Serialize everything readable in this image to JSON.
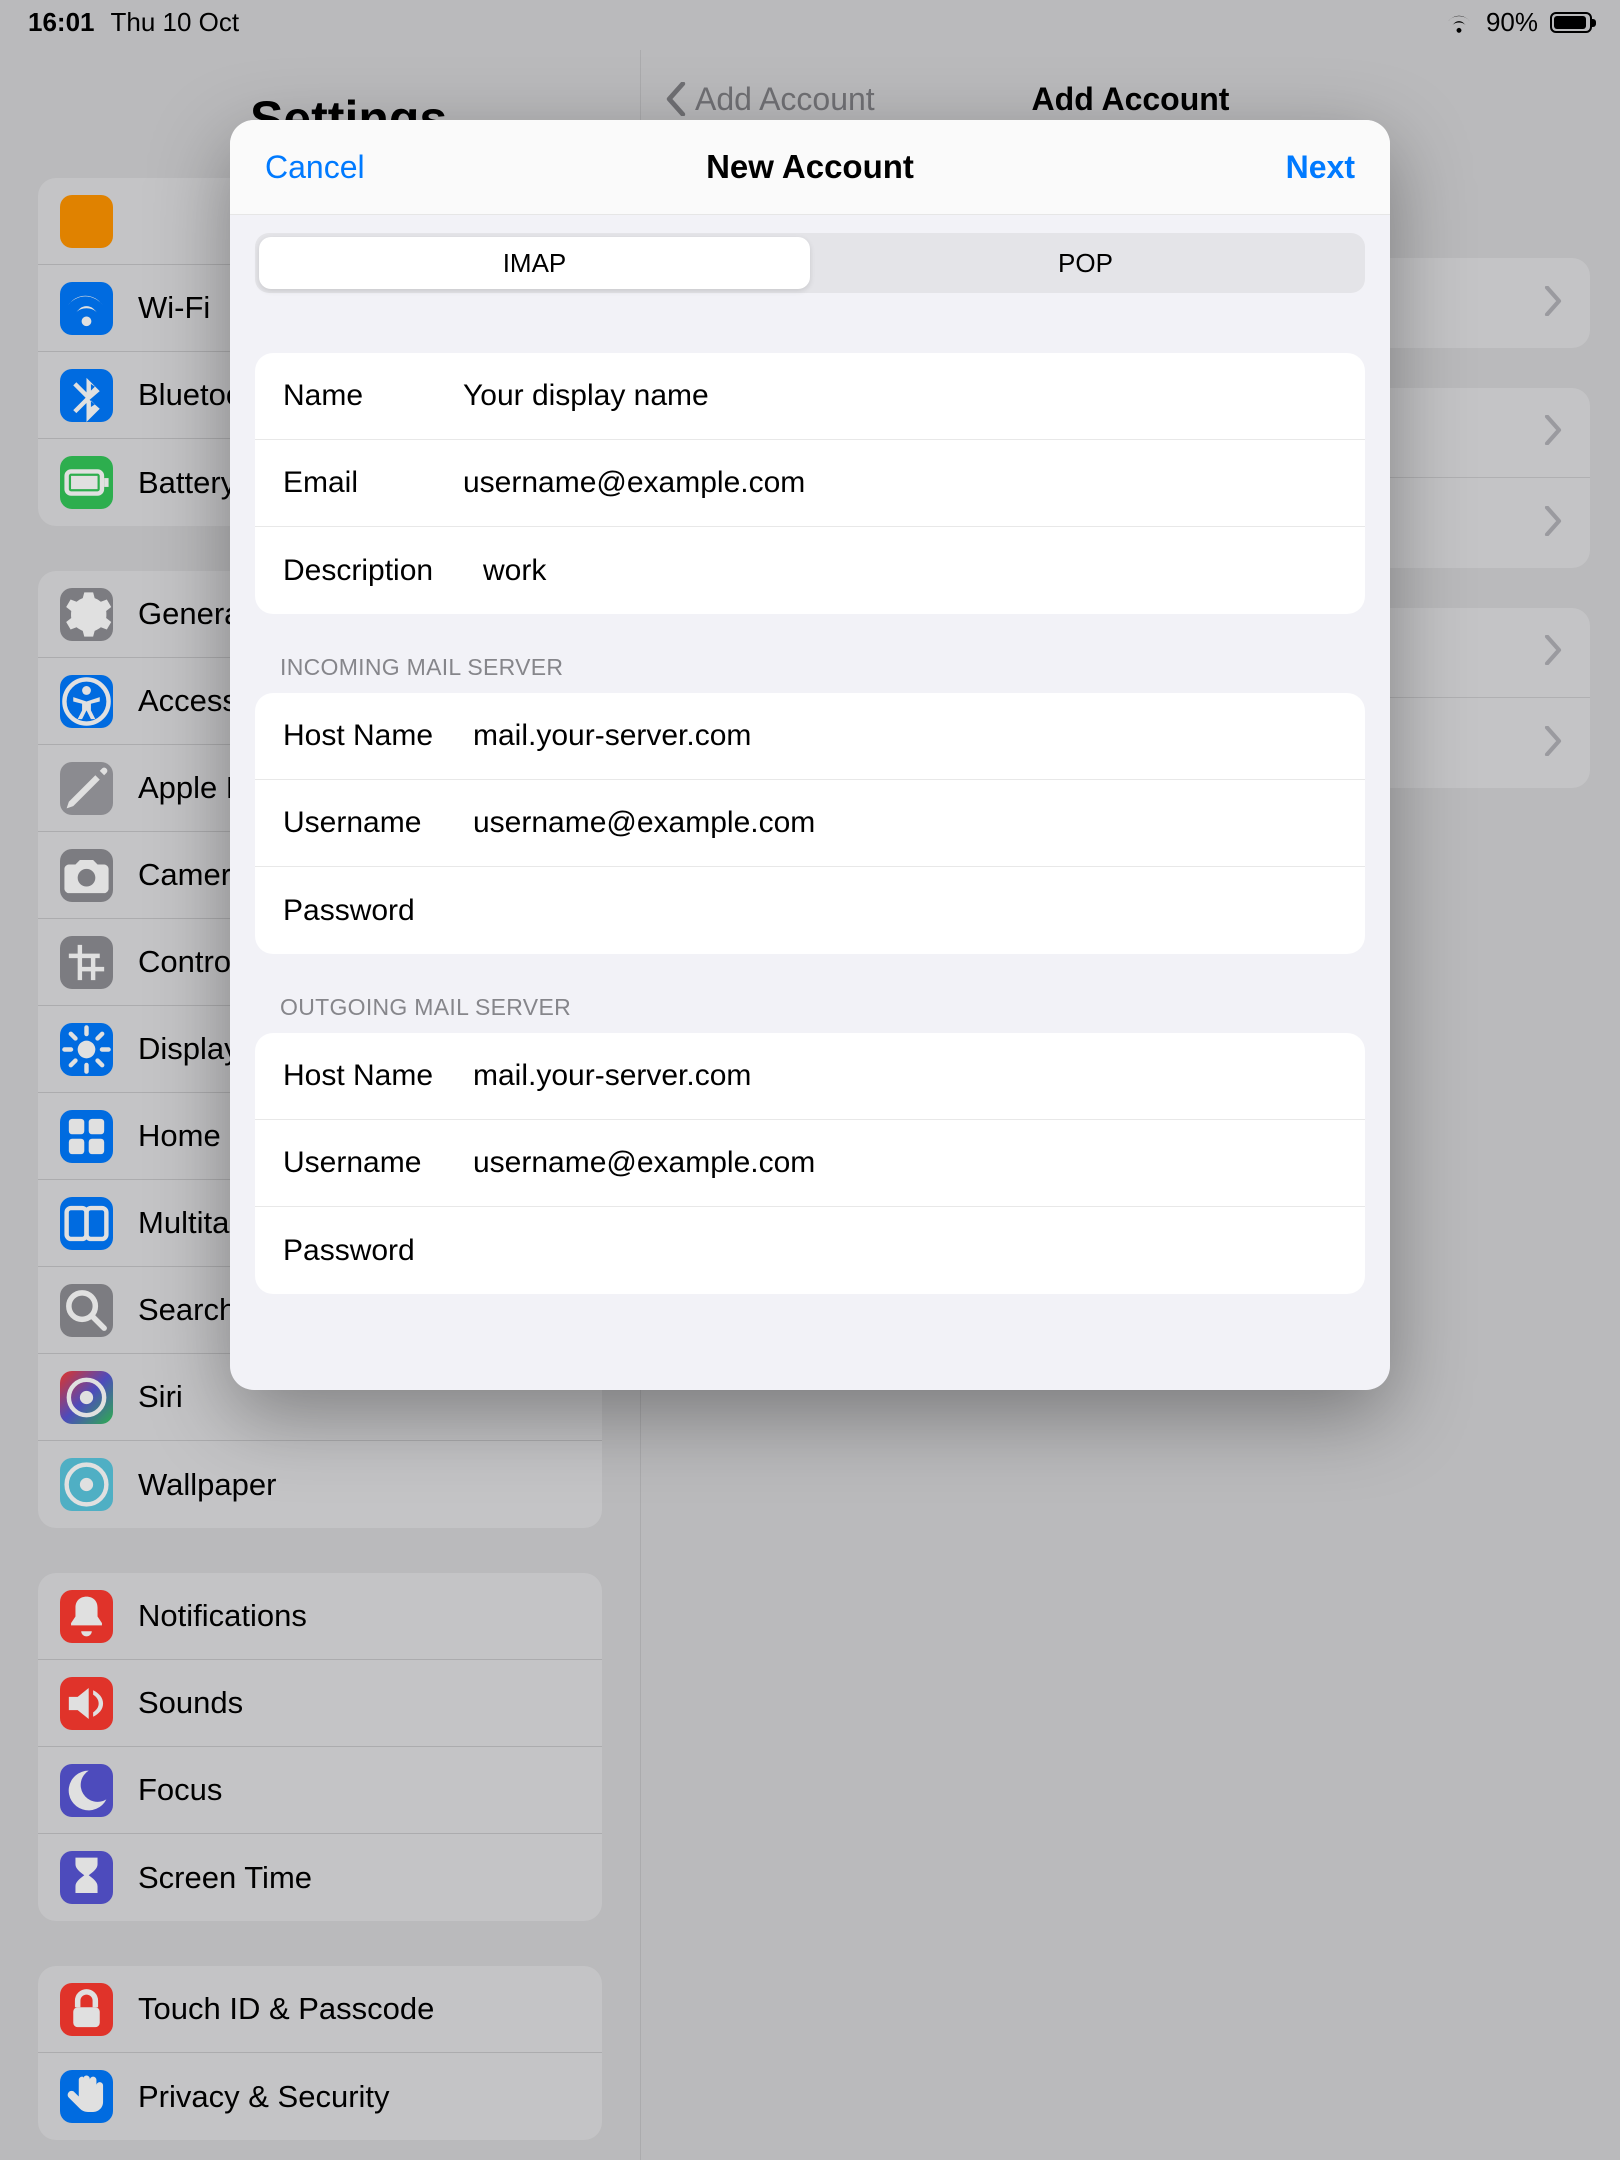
{
  "status": {
    "time": "16:01",
    "date": "Thu 10 Oct",
    "battery_pct": "90%"
  },
  "sidebar_title": "Settings",
  "sidebar": {
    "g1": [
      {
        "label": "",
        "color": "orange"
      },
      {
        "label": "Wi-Fi",
        "color": "blue",
        "glyph": "wifi"
      },
      {
        "label": "Bluetooth",
        "color": "blue",
        "glyph": "bt"
      },
      {
        "label": "Battery",
        "color": "green",
        "glyph": "batt"
      }
    ],
    "g2": [
      {
        "label": "General",
        "color": "grey",
        "glyph": "gear"
      },
      {
        "label": "Accessibility",
        "color": "blue",
        "glyph": "acc"
      },
      {
        "label": "Apple Pencil",
        "color": "ltgrey",
        "glyph": "pencil"
      },
      {
        "label": "Camera",
        "color": "grey",
        "glyph": "cam"
      },
      {
        "label": "Control Center",
        "color": "grey",
        "glyph": "ctrl"
      },
      {
        "label": "Display & Brightness",
        "color": "blue",
        "glyph": "sun"
      },
      {
        "label": "Home Screen & App Library",
        "color": "blue",
        "glyph": "home"
      },
      {
        "label": "Multitasking & Gestures",
        "color": "blue",
        "glyph": "multi"
      },
      {
        "label": "Search",
        "color": "grey",
        "glyph": "search"
      },
      {
        "label": "Siri",
        "color": "siri",
        "glyph": "siri"
      },
      {
        "label": "Wallpaper",
        "color": "cyan",
        "glyph": "wall"
      }
    ],
    "g3": [
      {
        "label": "Notifications",
        "color": "red",
        "glyph": "bell"
      },
      {
        "label": "Sounds",
        "color": "red",
        "glyph": "snd"
      },
      {
        "label": "Focus",
        "color": "purple",
        "glyph": "moon"
      },
      {
        "label": "Screen Time",
        "color": "purple",
        "glyph": "hour"
      }
    ],
    "g4": [
      {
        "label": "Touch ID & Passcode",
        "color": "red",
        "glyph": "lock"
      },
      {
        "label": "Privacy & Security",
        "color": "blue",
        "glyph": "hand"
      }
    ]
  },
  "detail": {
    "back_label": "Add Account",
    "title": "Add Account",
    "rows": 5
  },
  "modal": {
    "cancel": "Cancel",
    "title": "New Account",
    "next": "Next",
    "seg_imap": "IMAP",
    "seg_pop": "POP",
    "basic": {
      "name_label": "Name",
      "name_value": "Your display name",
      "email_label": "Email",
      "email_value": "username@example.com",
      "desc_label": "Description",
      "desc_value": "work"
    },
    "incoming_header": "INCOMING MAIL SERVER",
    "incoming": {
      "host_label": "Host Name",
      "host_value": "mail.your-server.com",
      "user_label": "Username",
      "user_value": "username@example.com",
      "pass_label": "Password",
      "pass_value": ""
    },
    "outgoing_header": "OUTGOING MAIL SERVER",
    "outgoing": {
      "host_label": "Host Name",
      "host_value": "mail.your-server.com",
      "user_label": "Username",
      "user_value": "username@example.com",
      "pass_label": "Password",
      "pass_value": ""
    }
  }
}
